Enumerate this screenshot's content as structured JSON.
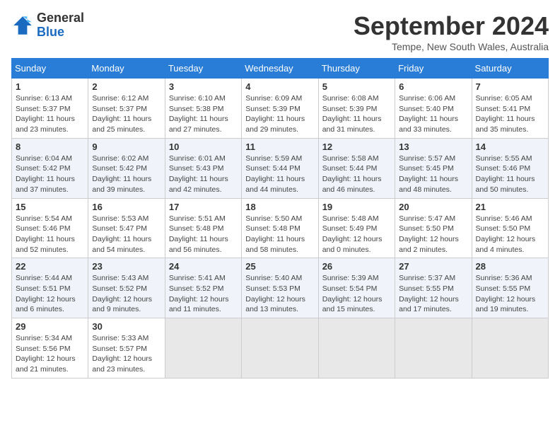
{
  "header": {
    "logo_general": "General",
    "logo_blue": "Blue",
    "month_title": "September 2024",
    "location": "Tempe, New South Wales, Australia"
  },
  "weekdays": [
    "Sunday",
    "Monday",
    "Tuesday",
    "Wednesday",
    "Thursday",
    "Friday",
    "Saturday"
  ],
  "weeks": [
    [
      {
        "day": "1",
        "sunrise": "6:13 AM",
        "sunset": "5:37 PM",
        "daylight": "11 hours and 23 minutes."
      },
      {
        "day": "2",
        "sunrise": "6:12 AM",
        "sunset": "5:37 PM",
        "daylight": "11 hours and 25 minutes."
      },
      {
        "day": "3",
        "sunrise": "6:10 AM",
        "sunset": "5:38 PM",
        "daylight": "11 hours and 27 minutes."
      },
      {
        "day": "4",
        "sunrise": "6:09 AM",
        "sunset": "5:39 PM",
        "daylight": "11 hours and 29 minutes."
      },
      {
        "day": "5",
        "sunrise": "6:08 AM",
        "sunset": "5:39 PM",
        "daylight": "11 hours and 31 minutes."
      },
      {
        "day": "6",
        "sunrise": "6:06 AM",
        "sunset": "5:40 PM",
        "daylight": "11 hours and 33 minutes."
      },
      {
        "day": "7",
        "sunrise": "6:05 AM",
        "sunset": "5:41 PM",
        "daylight": "11 hours and 35 minutes."
      }
    ],
    [
      {
        "day": "8",
        "sunrise": "6:04 AM",
        "sunset": "5:42 PM",
        "daylight": "11 hours and 37 minutes."
      },
      {
        "day": "9",
        "sunrise": "6:02 AM",
        "sunset": "5:42 PM",
        "daylight": "11 hours and 39 minutes."
      },
      {
        "day": "10",
        "sunrise": "6:01 AM",
        "sunset": "5:43 PM",
        "daylight": "11 hours and 42 minutes."
      },
      {
        "day": "11",
        "sunrise": "5:59 AM",
        "sunset": "5:44 PM",
        "daylight": "11 hours and 44 minutes."
      },
      {
        "day": "12",
        "sunrise": "5:58 AM",
        "sunset": "5:44 PM",
        "daylight": "11 hours and 46 minutes."
      },
      {
        "day": "13",
        "sunrise": "5:57 AM",
        "sunset": "5:45 PM",
        "daylight": "11 hours and 48 minutes."
      },
      {
        "day": "14",
        "sunrise": "5:55 AM",
        "sunset": "5:46 PM",
        "daylight": "11 hours and 50 minutes."
      }
    ],
    [
      {
        "day": "15",
        "sunrise": "5:54 AM",
        "sunset": "5:46 PM",
        "daylight": "11 hours and 52 minutes."
      },
      {
        "day": "16",
        "sunrise": "5:53 AM",
        "sunset": "5:47 PM",
        "daylight": "11 hours and 54 minutes."
      },
      {
        "day": "17",
        "sunrise": "5:51 AM",
        "sunset": "5:48 PM",
        "daylight": "11 hours and 56 minutes."
      },
      {
        "day": "18",
        "sunrise": "5:50 AM",
        "sunset": "5:48 PM",
        "daylight": "11 hours and 58 minutes."
      },
      {
        "day": "19",
        "sunrise": "5:48 AM",
        "sunset": "5:49 PM",
        "daylight": "12 hours and 0 minutes."
      },
      {
        "day": "20",
        "sunrise": "5:47 AM",
        "sunset": "5:50 PM",
        "daylight": "12 hours and 2 minutes."
      },
      {
        "day": "21",
        "sunrise": "5:46 AM",
        "sunset": "5:50 PM",
        "daylight": "12 hours and 4 minutes."
      }
    ],
    [
      {
        "day": "22",
        "sunrise": "5:44 AM",
        "sunset": "5:51 PM",
        "daylight": "12 hours and 6 minutes."
      },
      {
        "day": "23",
        "sunrise": "5:43 AM",
        "sunset": "5:52 PM",
        "daylight": "12 hours and 9 minutes."
      },
      {
        "day": "24",
        "sunrise": "5:41 AM",
        "sunset": "5:52 PM",
        "daylight": "12 hours and 11 minutes."
      },
      {
        "day": "25",
        "sunrise": "5:40 AM",
        "sunset": "5:53 PM",
        "daylight": "12 hours and 13 minutes."
      },
      {
        "day": "26",
        "sunrise": "5:39 AM",
        "sunset": "5:54 PM",
        "daylight": "12 hours and 15 minutes."
      },
      {
        "day": "27",
        "sunrise": "5:37 AM",
        "sunset": "5:55 PM",
        "daylight": "12 hours and 17 minutes."
      },
      {
        "day": "28",
        "sunrise": "5:36 AM",
        "sunset": "5:55 PM",
        "daylight": "12 hours and 19 minutes."
      }
    ],
    [
      {
        "day": "29",
        "sunrise": "5:34 AM",
        "sunset": "5:56 PM",
        "daylight": "12 hours and 21 minutes."
      },
      {
        "day": "30",
        "sunrise": "5:33 AM",
        "sunset": "5:57 PM",
        "daylight": "12 hours and 23 minutes."
      },
      null,
      null,
      null,
      null,
      null
    ]
  ],
  "labels": {
    "sunrise": "Sunrise:",
    "sunset": "Sunset:",
    "daylight": "Daylight:"
  }
}
